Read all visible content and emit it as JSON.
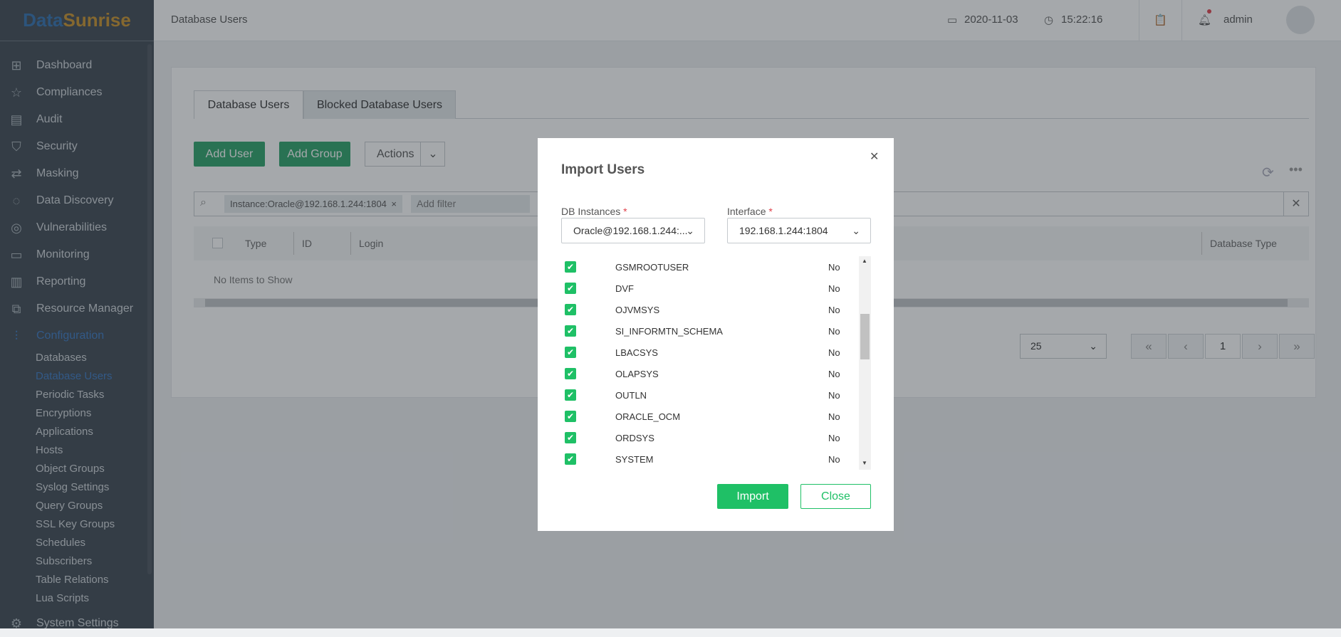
{
  "logo": {
    "part1": "Data",
    "part2": "Sunrise"
  },
  "sidebar": {
    "items": [
      {
        "label": "Dashboard",
        "icon": "dashboard-icon",
        "glyph": "⊞"
      },
      {
        "label": "Compliances",
        "icon": "star-icon",
        "glyph": "☆"
      },
      {
        "label": "Audit",
        "icon": "audit-icon",
        "glyph": "▤"
      },
      {
        "label": "Security",
        "icon": "shield-icon",
        "glyph": "⛉"
      },
      {
        "label": "Masking",
        "icon": "swap-icon",
        "glyph": "⇄"
      },
      {
        "label": "Data Discovery",
        "icon": "chat-icon",
        "glyph": "◌"
      },
      {
        "label": "Vulnerabilities",
        "icon": "target-icon",
        "glyph": "◎"
      },
      {
        "label": "Monitoring",
        "icon": "monitor-icon",
        "glyph": "▭"
      },
      {
        "label": "Reporting",
        "icon": "chart-icon",
        "glyph": "▥"
      },
      {
        "label": "Resource Manager",
        "icon": "code-icon",
        "glyph": "⧉"
      },
      {
        "label": "Configuration",
        "icon": "sliders-icon",
        "glyph": "⫶"
      }
    ],
    "sub_items": [
      "Databases",
      "Database Users",
      "Periodic Tasks",
      "Encryptions",
      "Applications",
      "Hosts",
      "Object Groups",
      "Syslog Settings",
      "Query Groups",
      "SSL Key Groups",
      "Schedules",
      "Subscribers",
      "Table Relations",
      "Lua Scripts"
    ],
    "cut_item": "System Settings"
  },
  "header": {
    "title": "Database Users",
    "date": "2020-11-03",
    "time": "15:22:16",
    "user": "admin"
  },
  "tabs": [
    "Database Users",
    "Blocked Database Users"
  ],
  "toolbar": {
    "add_user": "Add User",
    "add_group": "Add Group",
    "actions": "Actions"
  },
  "filter": {
    "chip": "Instance:Oracle@192.168.1.244:1804",
    "placeholder": "Add filter"
  },
  "table": {
    "columns": [
      "Type",
      "ID",
      "Login",
      "Database Type"
    ],
    "empty": "No Items to Show"
  },
  "pagination": {
    "page_size": "25",
    "current_page": "1"
  },
  "modal": {
    "title": "Import Users",
    "db_label": "DB Instances",
    "db_value": "Oracle@192.168.1.244:...",
    "iface_label": "Interface",
    "iface_value": "192.168.1.244:1804",
    "users": [
      {
        "name": "GSMROOTUSER",
        "value": "No"
      },
      {
        "name": "DVF",
        "value": "No"
      },
      {
        "name": "OJVMSYS",
        "value": "No"
      },
      {
        "name": "SI_INFORMTN_SCHEMA",
        "value": "No"
      },
      {
        "name": "LBACSYS",
        "value": "No"
      },
      {
        "name": "OLAPSYS",
        "value": "No"
      },
      {
        "name": "OUTLN",
        "value": "No"
      },
      {
        "name": "ORACLE_OCM",
        "value": "No"
      },
      {
        "name": "ORDSYS",
        "value": "No"
      },
      {
        "name": "SYSTEM",
        "value": "No"
      }
    ],
    "import": "Import",
    "close": "Close"
  },
  "colors": {
    "accent": "#2aa268",
    "modal_green": "#1fc066",
    "sidebar": "#3d4852",
    "active": "#3a78c2"
  }
}
